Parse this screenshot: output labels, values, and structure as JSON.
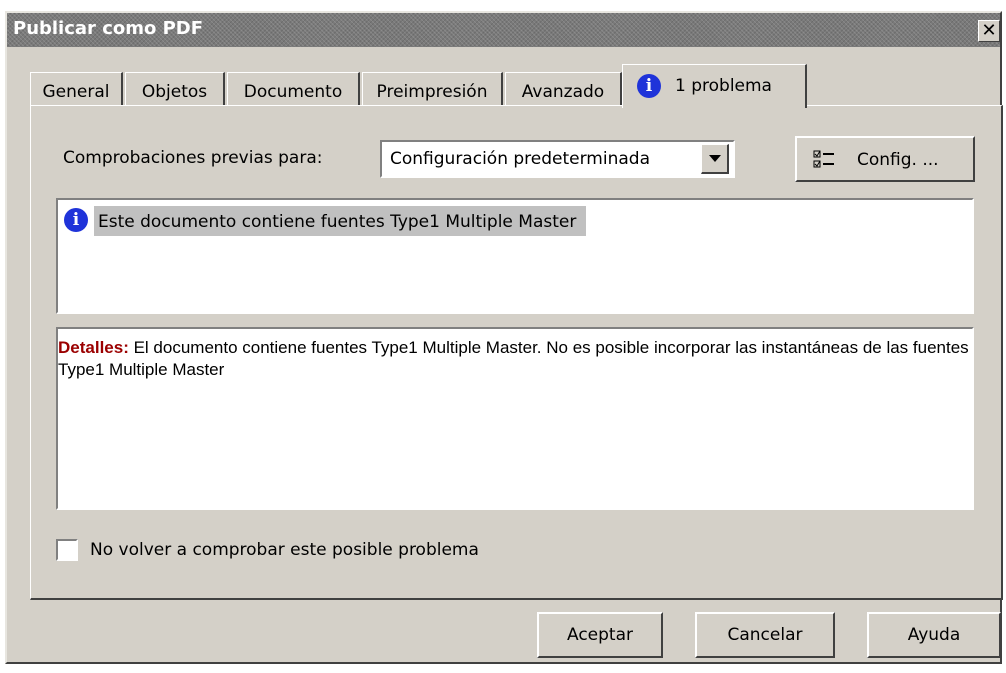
{
  "window": {
    "title": "Publicar como PDF",
    "close_glyph": "✕"
  },
  "tabs": [
    {
      "label": "General",
      "active": false
    },
    {
      "label": "Objetos",
      "active": false
    },
    {
      "label": "Documento",
      "active": false
    },
    {
      "label": "Preimpresión",
      "active": false
    },
    {
      "label": "Avanzado",
      "active": false
    },
    {
      "label": "1 problema",
      "active": true,
      "icon": "info-icon"
    }
  ],
  "preflight": {
    "label": "Comprobaciones previas para:",
    "selected": "Configuración predeterminada",
    "config_button": "Config. ..."
  },
  "problems": [
    {
      "icon": "info-icon",
      "text": "Este documento contiene fuentes Type1 Multiple Master"
    }
  ],
  "details": {
    "label": "Detalles:",
    "text": " El documento contiene fuentes Type1 Multiple Master. No es posible incorporar las instantáneas de las fuentes Type1 Multiple Master"
  },
  "checkbox": {
    "label": "No volver a comprobar este posible problema",
    "checked": false
  },
  "buttons": {
    "ok": "Aceptar",
    "cancel": "Cancelar",
    "help": "Ayuda"
  },
  "colors": {
    "info_icon": "#1f33d9",
    "details_label": "#9b0000",
    "dialog_bg": "#d4d0c8"
  }
}
